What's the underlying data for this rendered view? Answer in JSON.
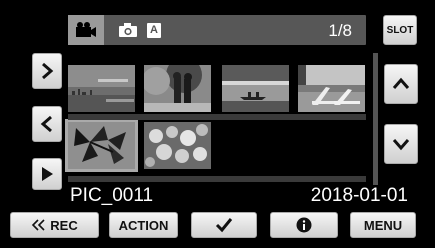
{
  "mode_bar": {
    "modes": [
      {
        "name": "video",
        "icon": "video-camera-icon",
        "selected": true
      },
      {
        "name": "photo",
        "icon": "camera-icon",
        "selected": false
      },
      {
        "name": "auto",
        "icon": "auto-mode-icon",
        "label": "A",
        "selected": false
      }
    ],
    "page_indicator": "1/8",
    "slot_label": "SLOT"
  },
  "navigation": {
    "next_icon": "chevron-right-icon",
    "prev_icon": "chevron-left-icon",
    "play_icon": "play-icon",
    "scroll_up_icon": "chevron-up-icon",
    "scroll_down_icon": "chevron-down-icon"
  },
  "thumbnails": [
    {
      "name": "thumb-skyline",
      "selected": false
    },
    {
      "name": "thumb-couple",
      "selected": false
    },
    {
      "name": "thumb-canoe",
      "selected": false
    },
    {
      "name": "thumb-beach-chairs",
      "selected": false
    },
    {
      "name": "thumb-leaves",
      "selected": true
    },
    {
      "name": "thumb-flowers",
      "selected": false
    }
  ],
  "file_info": {
    "filename": "PIC_0011",
    "date": "2018-01-01"
  },
  "bottom_bar": {
    "rec_label": "REC",
    "rec_icon": "double-chevron-left-icon",
    "action_label": "ACTION",
    "check_icon": "checkmark-icon",
    "info_icon": "info-icon",
    "menu_label": "MENU"
  },
  "colors": {
    "background": "#000000",
    "mode_bar": "#575757",
    "selected_mode": "#9a9a9a",
    "button_light": "#f0f0f0"
  }
}
